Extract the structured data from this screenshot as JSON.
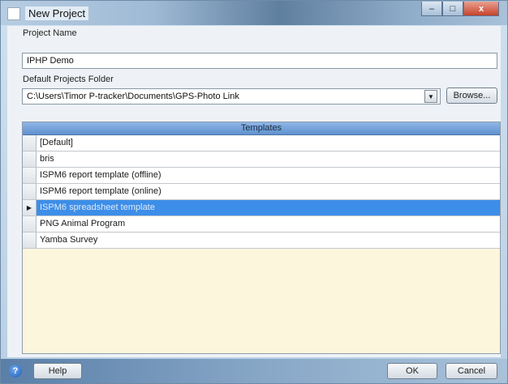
{
  "window": {
    "title": "New Project",
    "min_glyph": "–",
    "max_glyph": "□",
    "close_glyph": "x"
  },
  "project_name": {
    "label": "Project Name",
    "value": "IPHP Demo"
  },
  "folder": {
    "label": "Default Projects Folder",
    "value": "C:\\Users\\Timor P-tracker\\Documents\\GPS-Photo Link",
    "dropdown_glyph": "▼",
    "browse_label": "Browse..."
  },
  "templates": {
    "header": "Templates",
    "current_row_glyph": "▶",
    "rows": [
      "[Default]",
      "bris",
      "ISPM6 report template (offline)",
      "ISPM6 report template (online)",
      "ISPM6 spreadsheet template",
      "PNG Animal Program",
      "Yamba Survey"
    ],
    "selected_index": 4
  },
  "footer": {
    "help_glyph": "?",
    "help_label": "Help",
    "ok_label": "OK",
    "cancel_label": "Cancel"
  }
}
